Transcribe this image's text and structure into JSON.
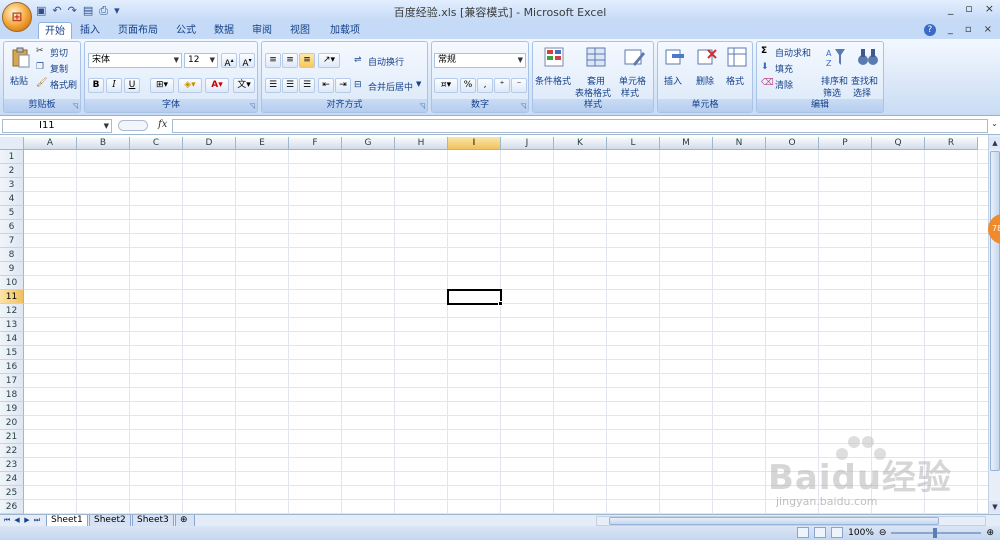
{
  "window": {
    "title": "百度经验.xls  [兼容模式] - Microsoft Excel",
    "controls": [
      "_",
      "▫",
      "×"
    ],
    "ribbon_controls": [
      "_",
      "▫",
      "×"
    ]
  },
  "tabs": [
    {
      "label": "开始",
      "active": true
    },
    {
      "label": "插入"
    },
    {
      "label": "页面布局"
    },
    {
      "label": "公式"
    },
    {
      "label": "数据"
    },
    {
      "label": "审阅"
    },
    {
      "label": "视图"
    },
    {
      "label": "加载项"
    }
  ],
  "ribbon": {
    "clipboard": {
      "label": "剪贴板",
      "paste": "粘贴",
      "cut": "剪切",
      "copy": "复制",
      "format_painter": "格式刷"
    },
    "font": {
      "label": "字体",
      "font_name": "宋体",
      "font_size": "12",
      "bold": "B",
      "italic": "I",
      "underline": "U"
    },
    "alignment": {
      "label": "对齐方式",
      "wrap_text": "自动换行",
      "merge_center": "合并后居中"
    },
    "number": {
      "label": "数字",
      "format": "常规",
      "percent": "%",
      "comma": ","
    },
    "styles": {
      "label": "样式",
      "conditional": "条件格式",
      "table_1": "套用",
      "table_2": "表格格式",
      "cell_styles_1": "单元格",
      "cell_styles_2": "样式"
    },
    "cells": {
      "label": "单元格",
      "insert": "插入",
      "delete": "删除",
      "format": "格式"
    },
    "editing": {
      "label": "编辑",
      "autosum": "自动求和",
      "fill": "填充",
      "clear": "清除",
      "sort_1": "排序和",
      "sort_2": "筛选",
      "find_1": "查找和",
      "find_2": "选择"
    }
  },
  "formula_bar": {
    "name_box": "I11",
    "fx": "fx",
    "value": ""
  },
  "columns": [
    "A",
    "B",
    "C",
    "D",
    "E",
    "F",
    "G",
    "H",
    "I",
    "J",
    "K",
    "L",
    "M",
    "N",
    "O",
    "P",
    "Q",
    "R"
  ],
  "rows": [
    "1",
    "2",
    "3",
    "4",
    "5",
    "6",
    "7",
    "8",
    "9",
    "10",
    "11",
    "12",
    "13",
    "14",
    "15",
    "16",
    "17",
    "18",
    "19",
    "20",
    "21",
    "22",
    "23",
    "24",
    "25",
    "26"
  ],
  "selected": {
    "column": "I",
    "row": "11"
  },
  "sheet_tabs": [
    "Sheet1",
    "Sheet2",
    "Sheet3"
  ],
  "status": {
    "zoom": "100%"
  },
  "side_badge": "78",
  "watermark": {
    "main": "Baidu经验",
    "sub": "jingyan.baidu.com"
  },
  "colors": {
    "accent": "#15428b",
    "selection_header": "#f1c15f",
    "ribbon_bg": "#dae7f8"
  }
}
